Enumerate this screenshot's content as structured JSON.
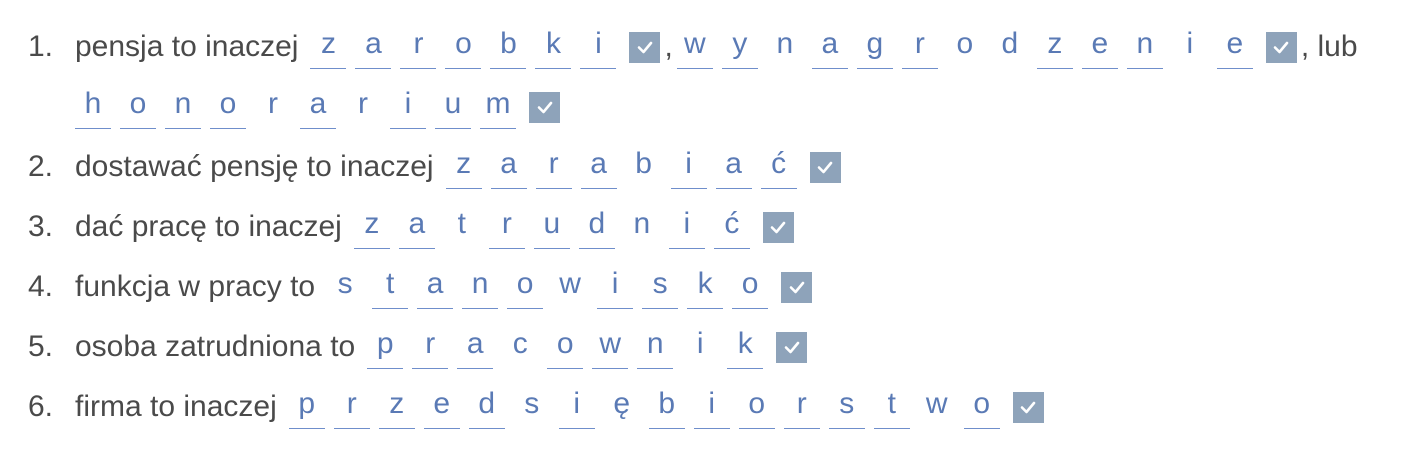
{
  "accent_color": "#5a7ab5",
  "check_color": "#8ea3ba",
  "check_icon": "checkmark-icon",
  "items": [
    {
      "number": "1.",
      "segments": [
        {
          "kind": "text",
          "text": "pensja to inaczej"
        },
        {
          "kind": "word",
          "letters": [
            {
              "ch": "z",
              "blank": true
            },
            {
              "ch": "a",
              "blank": true
            },
            {
              "ch": "r",
              "blank": true
            },
            {
              "ch": "o",
              "blank": true
            },
            {
              "ch": "b",
              "blank": true
            },
            {
              "ch": "k",
              "blank": true
            },
            {
              "ch": "i",
              "blank": true
            }
          ]
        },
        {
          "kind": "sep",
          "text": ","
        },
        {
          "kind": "word",
          "letters": [
            {
              "ch": "w",
              "blank": true
            },
            {
              "ch": "y",
              "blank": true
            },
            {
              "ch": "n",
              "blank": false
            },
            {
              "ch": "a",
              "blank": true
            },
            {
              "ch": "g",
              "blank": true
            },
            {
              "ch": "r",
              "blank": true
            },
            {
              "ch": "o",
              "blank": false
            },
            {
              "ch": "d",
              "blank": false
            },
            {
              "ch": "z",
              "blank": true
            },
            {
              "ch": "e",
              "blank": true
            },
            {
              "ch": "n",
              "blank": true
            },
            {
              "ch": "i",
              "blank": false
            },
            {
              "ch": "e",
              "blank": true
            }
          ]
        },
        {
          "kind": "sep",
          "text": ", lub"
        },
        {
          "kind": "break"
        },
        {
          "kind": "word",
          "letters": [
            {
              "ch": "h",
              "blank": true
            },
            {
              "ch": "o",
              "blank": true
            },
            {
              "ch": "n",
              "blank": true
            },
            {
              "ch": "o",
              "blank": true
            },
            {
              "ch": "r",
              "blank": false
            },
            {
              "ch": "a",
              "blank": true
            },
            {
              "ch": "r",
              "blank": false
            },
            {
              "ch": "i",
              "blank": true
            },
            {
              "ch": "u",
              "blank": true
            },
            {
              "ch": "m",
              "blank": true
            }
          ]
        }
      ]
    },
    {
      "number": "2.",
      "segments": [
        {
          "kind": "text",
          "text": "dostawać pensję to inaczej"
        },
        {
          "kind": "word",
          "letters": [
            {
              "ch": "z",
              "blank": true
            },
            {
              "ch": "a",
              "blank": true
            },
            {
              "ch": "r",
              "blank": true
            },
            {
              "ch": "a",
              "blank": true
            },
            {
              "ch": "b",
              "blank": false
            },
            {
              "ch": "i",
              "blank": true
            },
            {
              "ch": "a",
              "blank": true
            },
            {
              "ch": "ć",
              "blank": true
            }
          ]
        }
      ]
    },
    {
      "number": "3.",
      "segments": [
        {
          "kind": "text",
          "text": "dać pracę to inaczej"
        },
        {
          "kind": "word",
          "letters": [
            {
              "ch": "z",
              "blank": true
            },
            {
              "ch": "a",
              "blank": true
            },
            {
              "ch": "t",
              "blank": false
            },
            {
              "ch": "r",
              "blank": true
            },
            {
              "ch": "u",
              "blank": true
            },
            {
              "ch": "d",
              "blank": true
            },
            {
              "ch": "n",
              "blank": false
            },
            {
              "ch": "i",
              "blank": true
            },
            {
              "ch": "ć",
              "blank": true
            }
          ]
        }
      ]
    },
    {
      "number": "4.",
      "segments": [
        {
          "kind": "text",
          "text": "funkcja w pracy to"
        },
        {
          "kind": "word",
          "letters": [
            {
              "ch": "s",
              "blank": false
            },
            {
              "ch": "t",
              "blank": true
            },
            {
              "ch": "a",
              "blank": true
            },
            {
              "ch": "n",
              "blank": true
            },
            {
              "ch": "o",
              "blank": true
            },
            {
              "ch": "w",
              "blank": false
            },
            {
              "ch": "i",
              "blank": true
            },
            {
              "ch": "s",
              "blank": true
            },
            {
              "ch": "k",
              "blank": true
            },
            {
              "ch": "o",
              "blank": true
            }
          ]
        }
      ]
    },
    {
      "number": "5.",
      "segments": [
        {
          "kind": "text",
          "text": "osoba zatrudniona to"
        },
        {
          "kind": "word",
          "letters": [
            {
              "ch": "p",
              "blank": true
            },
            {
              "ch": "r",
              "blank": true
            },
            {
              "ch": "a",
              "blank": true
            },
            {
              "ch": "c",
              "blank": false
            },
            {
              "ch": "o",
              "blank": true
            },
            {
              "ch": "w",
              "blank": true
            },
            {
              "ch": "n",
              "blank": true
            },
            {
              "ch": "i",
              "blank": false
            },
            {
              "ch": "k",
              "blank": true
            }
          ]
        }
      ]
    },
    {
      "number": "6.",
      "segments": [
        {
          "kind": "text",
          "text": "firma to inaczej"
        },
        {
          "kind": "word",
          "letters": [
            {
              "ch": "p",
              "blank": true
            },
            {
              "ch": "r",
              "blank": true
            },
            {
              "ch": "z",
              "blank": true
            },
            {
              "ch": "e",
              "blank": true
            },
            {
              "ch": "d",
              "blank": true
            },
            {
              "ch": "s",
              "blank": false
            },
            {
              "ch": "i",
              "blank": true
            },
            {
              "ch": "ę",
              "blank": false
            },
            {
              "ch": "b",
              "blank": true
            },
            {
              "ch": "i",
              "blank": true
            },
            {
              "ch": "o",
              "blank": true
            },
            {
              "ch": "r",
              "blank": true
            },
            {
              "ch": "s",
              "blank": true
            },
            {
              "ch": "t",
              "blank": true
            },
            {
              "ch": "w",
              "blank": false
            },
            {
              "ch": "o",
              "blank": true
            }
          ]
        }
      ]
    }
  ]
}
